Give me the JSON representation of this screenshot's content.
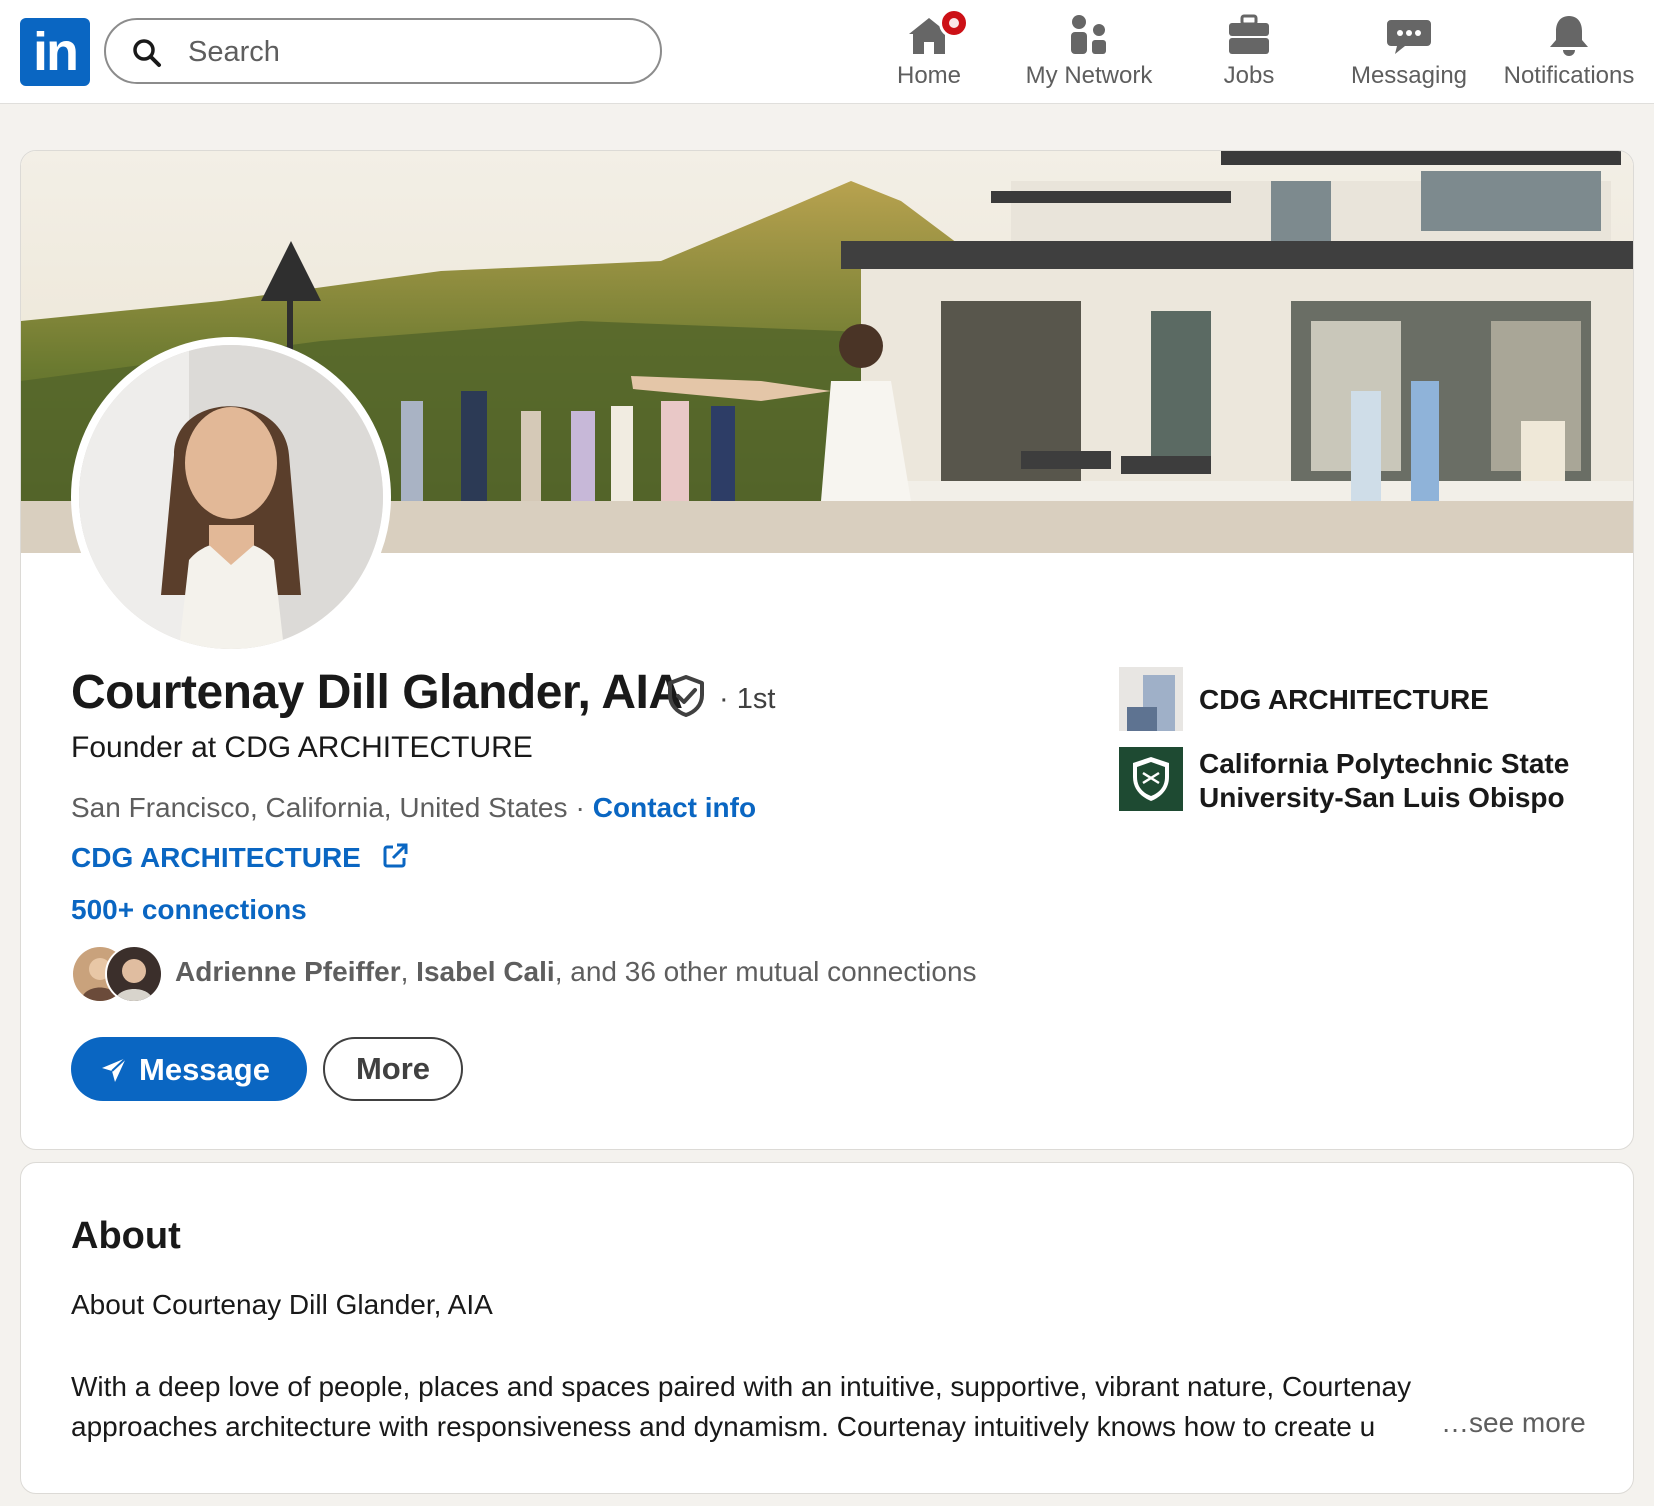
{
  "nav": {
    "logo_text": "in",
    "search_placeholder": "Search",
    "items": [
      {
        "label": "Home",
        "icon": "home-icon"
      },
      {
        "label": "My Network",
        "icon": "people-icon"
      },
      {
        "label": "Jobs",
        "icon": "briefcase-icon"
      },
      {
        "label": "Messaging",
        "icon": "chat-icon"
      },
      {
        "label": "Notifications",
        "icon": "bell-icon"
      }
    ]
  },
  "profile": {
    "name": "Courtenay Dill Glander, AIA",
    "degree": "· 1st",
    "headline": "Founder at CDG ARCHITECTURE",
    "location": "San Francisco, California, United States",
    "location_sep": "·",
    "contact_info": "Contact info",
    "website": "CDG ARCHITECTURE",
    "connections": "500+ connections",
    "mutual": {
      "name1": "Adrienne Pfeiffer",
      "sep1": ", ",
      "name2": "Isabel Cali",
      "rest": ", and 36 other mutual connections"
    },
    "message_button": "Message",
    "more_button": "More",
    "current_company": "CDG ARCHITECTURE",
    "education": "California Polytechnic State University-San Luis Obispo"
  },
  "about": {
    "title": "About",
    "subtitle": "About Courtenay Dill Glander, AIA",
    "line1": "With a deep love of people, places and spaces paired with an intuitive, supportive, vibrant nature, Courtenay",
    "line2": "approaches architecture with responsiveness and dynamism. Courtenay intuitively knows how to create u",
    "see_more": "…see more"
  },
  "colors": {
    "brand": "#0a66c2",
    "page_bg": "#f4f2ee",
    "badge": "#cc1016",
    "school_green": "#1e4a32"
  }
}
